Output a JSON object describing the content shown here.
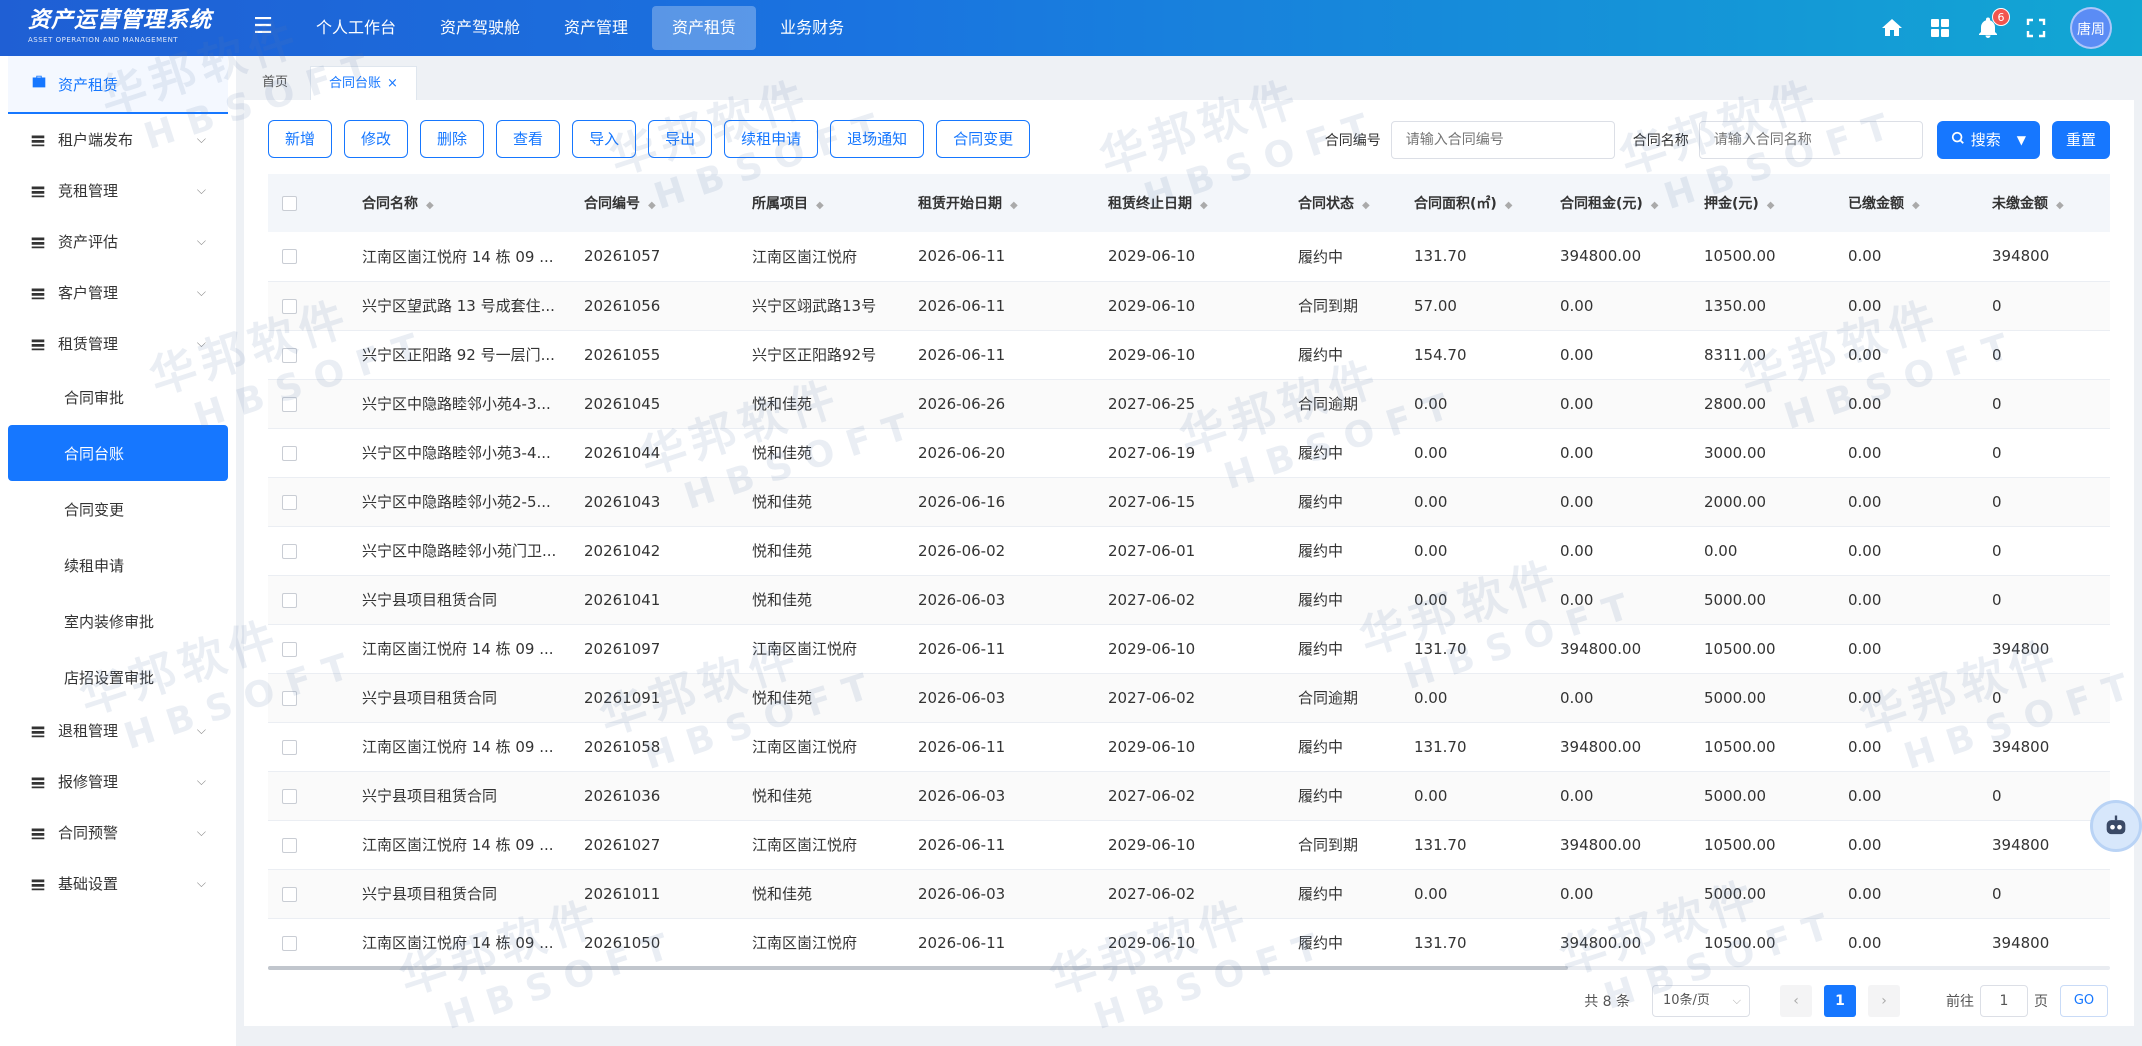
{
  "app": {
    "title": "资产运营管理系统",
    "subtitle": "ASSET OPERATION AND MANAGEMENT",
    "user": "唐周",
    "notifications": "6"
  },
  "topnav": [
    {
      "label": "个人工作台"
    },
    {
      "label": "资产驾驶舱"
    },
    {
      "label": "资产管理"
    },
    {
      "label": "资产租赁"
    },
    {
      "label": "业务财务"
    }
  ],
  "sidebar": {
    "header": "资产租赁",
    "items_before": [
      {
        "label": "租户端发布"
      },
      {
        "label": "竞租管理"
      },
      {
        "label": "资产评估"
      },
      {
        "label": "客户管理"
      },
      {
        "label": "租赁管理"
      }
    ],
    "sub_items": [
      {
        "label": "合同审批"
      },
      {
        "label": "合同台账"
      },
      {
        "label": "合同变更"
      },
      {
        "label": "续租申请"
      },
      {
        "label": "室内装修审批"
      },
      {
        "label": "店招设置审批"
      }
    ],
    "items_after": [
      {
        "label": "退租管理"
      },
      {
        "label": "报修管理"
      },
      {
        "label": "合同预警"
      },
      {
        "label": "基础设置"
      }
    ]
  },
  "tabs": [
    {
      "label": "首页"
    },
    {
      "label": "合同台账"
    }
  ],
  "toolbar": [
    "新增",
    "修改",
    "删除",
    "查看",
    "导入",
    "导出",
    "续租申请",
    "退场通知",
    "合同变更"
  ],
  "filters": {
    "code_label": "合同编号",
    "code_placeholder": "请输入合同编号",
    "name_label": "合同名称",
    "name_placeholder": "请输入合同名称",
    "search": "搜索",
    "reset": "重置"
  },
  "table": {
    "columns": [
      "合同名称",
      "合同编号",
      "所属项目",
      "租赁开始日期",
      "租赁终止日期",
      "合同状态",
      "合同面积(㎡)",
      "合同租金(元)",
      "押金(元)",
      "已缴金额",
      "未缴金额"
    ],
    "rows": [
      [
        "江南区崮江悦府 14 栋 09 ...",
        "20261057",
        "江南区崮江悦府",
        "2026-06-11",
        "2029-06-10",
        "履约中",
        "131.70",
        "394800.00",
        "10500.00",
        "0.00",
        "394800"
      ],
      [
        "兴宁区望武路 13 号成套住...",
        "20261056",
        "兴宁区翊武路13号",
        "2026-06-11",
        "2029-06-10",
        "合同到期",
        "57.00",
        "0.00",
        "1350.00",
        "0.00",
        "0"
      ],
      [
        "兴宁区正阳路 92 号一层门...",
        "20261055",
        "兴宁区正阳路92号",
        "2026-06-11",
        "2029-06-10",
        "履约中",
        "154.70",
        "0.00",
        "8311.00",
        "0.00",
        "0"
      ],
      [
        "兴宁区中隐路睦邻小苑4-3...",
        "20261045",
        "悦和佳苑",
        "2026-06-26",
        "2027-06-25",
        "合同逾期",
        "0.00",
        "0.00",
        "2800.00",
        "0.00",
        "0"
      ],
      [
        "兴宁区中隐路睦邻小苑3-4...",
        "20261044",
        "悦和佳苑",
        "2026-06-20",
        "2027-06-19",
        "履约中",
        "0.00",
        "0.00",
        "3000.00",
        "0.00",
        "0"
      ],
      [
        "兴宁区中隐路睦邻小苑2-5...",
        "20261043",
        "悦和佳苑",
        "2026-06-16",
        "2027-06-15",
        "履约中",
        "0.00",
        "0.00",
        "2000.00",
        "0.00",
        "0"
      ],
      [
        "兴宁区中隐路睦邻小苑门卫...",
        "20261042",
        "悦和佳苑",
        "2026-06-02",
        "2027-06-01",
        "履约中",
        "0.00",
        "0.00",
        "0.00",
        "0.00",
        "0"
      ],
      [
        "兴宁县项目租赁合同",
        "20261041",
        "悦和佳苑",
        "2026-06-03",
        "2027-06-02",
        "履约中",
        "0.00",
        "0.00",
        "5000.00",
        "0.00",
        "0"
      ],
      [
        "江南区崮江悦府 14 栋 09 ...",
        "20261097",
        "江南区崮江悦府",
        "2026-06-11",
        "2029-06-10",
        "履约中",
        "131.70",
        "394800.00",
        "10500.00",
        "0.00",
        "394800"
      ],
      [
        "兴宁县项目租赁合同",
        "20261091",
        "悦和佳苑",
        "2026-06-03",
        "2027-06-02",
        "合同逾期",
        "0.00",
        "0.00",
        "5000.00",
        "0.00",
        "0"
      ],
      [
        "江南区崮江悦府 14 栋 09 ...",
        "20261058",
        "江南区崮江悦府",
        "2026-06-11",
        "2029-06-10",
        "履约中",
        "131.70",
        "394800.00",
        "10500.00",
        "0.00",
        "394800"
      ],
      [
        "兴宁县项目租赁合同",
        "20261036",
        "悦和佳苑",
        "2026-06-03",
        "2027-06-02",
        "履约中",
        "0.00",
        "0.00",
        "5000.00",
        "0.00",
        "0"
      ],
      [
        "江南区崮江悦府 14 栋 09 ...",
        "20261027",
        "江南区崮江悦府",
        "2026-06-11",
        "2029-06-10",
        "合同到期",
        "131.70",
        "394800.00",
        "10500.00",
        "0.00",
        "394800"
      ],
      [
        "兴宁县项目租赁合同",
        "20261011",
        "悦和佳苑",
        "2026-06-03",
        "2027-06-02",
        "履约中",
        "0.00",
        "0.00",
        "5000.00",
        "0.00",
        "0"
      ],
      [
        "江南区崮江悦府 14 栋 09 ...",
        "20261050",
        "江南区崮江悦府",
        "2026-06-11",
        "2029-06-10",
        "履约中",
        "131.70",
        "394800.00",
        "10500.00",
        "0.00",
        "394800"
      ]
    ]
  },
  "pagination": {
    "total": "共 8 条",
    "page_size": "10条/页",
    "current": "1",
    "goto_label": "前往",
    "goto_value": "1",
    "page_unit": "页",
    "go": "GO"
  },
  "watermark": {
    "cn": "华邦软件",
    "en": "HBSOFT"
  }
}
